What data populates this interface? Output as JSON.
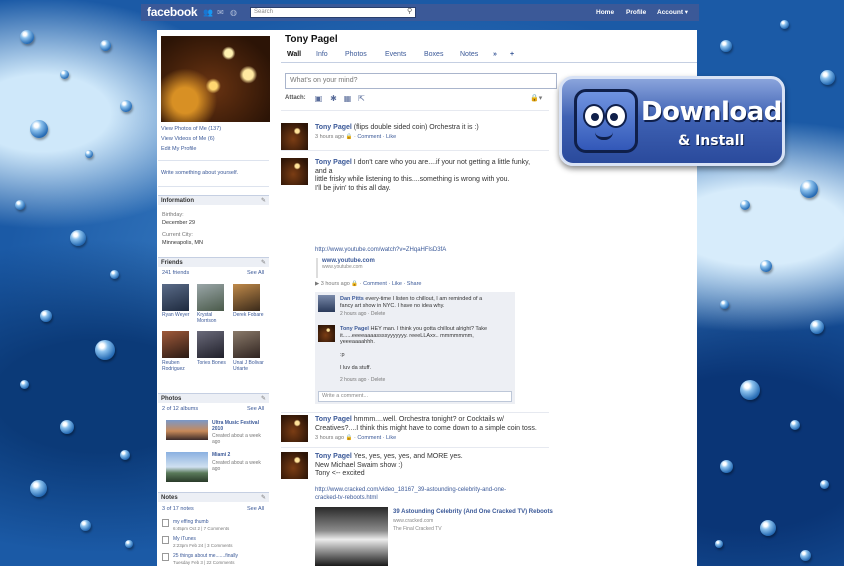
{
  "topbar": {
    "logo": "facebook",
    "search_placeholder": "Search",
    "links": [
      "Home",
      "Profile",
      "Account ▾"
    ]
  },
  "profile": {
    "name": "Tony Pagel",
    "links": [
      "View Photos of Me (137)",
      "View Videos of Me (6)",
      "Edit My Profile"
    ],
    "write_about": "Write something about yourself."
  },
  "information": {
    "heading": "Information",
    "birthday_label": "Birthday:",
    "birthday": "December 29",
    "city_label": "Current City:",
    "city": "Minneapolis, MN"
  },
  "friends": {
    "heading": "Friends",
    "count": "241 friends",
    "see_all": "See All",
    "people": [
      {
        "name": "Ryan Weyer"
      },
      {
        "name": "Krystal Morrison"
      },
      {
        "name": "Derek Fobare"
      },
      {
        "name": "Reuben Rodriguez"
      },
      {
        "name": "Tories Bones"
      },
      {
        "name": "Unai J Bolivar Uriarte"
      }
    ]
  },
  "photos": {
    "heading": "Photos",
    "count": "2 of 12 albums",
    "see_all": "See All",
    "albums": [
      {
        "title": "Ultra Music Festival 2010",
        "meta": "Created about a week ago"
      },
      {
        "title": "Miami 2",
        "meta": "Created about a week ago"
      }
    ]
  },
  "notes": {
    "heading": "Notes",
    "count": "3 of 17 notes",
    "see_all": "See All",
    "items": [
      {
        "title": "my effing thumb",
        "meta": "6:45pm Oct 2 | 7 Comments"
      },
      {
        "title": "My iTunes",
        "meta": "2:23pm Feb 24 | 3 Comments"
      },
      {
        "title": "25 things about me.......finally",
        "meta": "Tuesday Feb 3 | 22 Comments"
      }
    ]
  },
  "tabs": [
    "Wall",
    "Info",
    "Photos",
    "Events",
    "Boxes",
    "Notes",
    "»",
    "+"
  ],
  "composer": {
    "placeholder": "What's on your mind?",
    "attach_label": "Attach:"
  },
  "posts": [
    {
      "author": "Tony Pagel",
      "text": "(flips double sided coin) Orchestra it is :)",
      "meta": "3 hours ago",
      "actions": "Comment · Like"
    },
    {
      "author": "Tony Pagel",
      "text_lines": [
        "I don't care who you are....if your not getting a little funky,",
        "and a",
        "little frisky while listening to this....something is wrong with you.",
        "I'll be jivin' to this all day."
      ],
      "url": "http://www.youtube.com/watch?v=ZHqaHFlsD3fA",
      "link_title": "www.youtube.com",
      "link_domain": "www.youtube.com",
      "meta": "3 hours ago",
      "actions": "Comment · Like · Share",
      "comments": [
        {
          "author": "Dan Pitts",
          "text_lines": [
            "every-time I listen to chillout, I am reminded of a",
            "fancy art show in NYC. I have no idea why."
          ],
          "meta": "2 hours ago · Delete"
        },
        {
          "author": "Tony Pagel",
          "text_lines": [
            "HEY man. I think you gotta chillout alright? Take",
            "it......eeeeaaaassssyyyyyyy. reeeLLAxx.. mmmmmmm,",
            "yeeeaaaahhh.",
            "",
            ":p",
            "",
            "I luv da stuff."
          ],
          "meta": "2 hours ago · Delete"
        }
      ],
      "write_comment": "Write a comment..."
    },
    {
      "author": "Tony Pagel",
      "text_lines": [
        "hmmm....well. Orchestra tonight? or Cocktails w/",
        "Creatives?....I think this might have to come down to a simple coin toss."
      ],
      "meta": "3 hours ago",
      "actions": "Comment · Like"
    },
    {
      "author": "Tony Pagel",
      "text_lines": [
        "Yes, yes, yes, yes, and MORE yes.",
        "New Michael Swaim show :)",
        "Tony <-- excited"
      ],
      "url_lines": [
        "http://www.cracked.com/video_18167_39-astounding-celebrity-and-one-",
        "cracked-tv-reboots.html"
      ],
      "link_title": "39 Astounding Celebrity (And One Cracked TV) Reboots",
      "link_domain": "www.cracked.com",
      "link_desc": "The Final Cracked TV"
    }
  ],
  "badge": {
    "line1": "Download",
    "line2": "& Install"
  },
  "colors": {
    "brand": "#3b5998",
    "link": "#3b5998",
    "badge": "#3f62b4"
  }
}
